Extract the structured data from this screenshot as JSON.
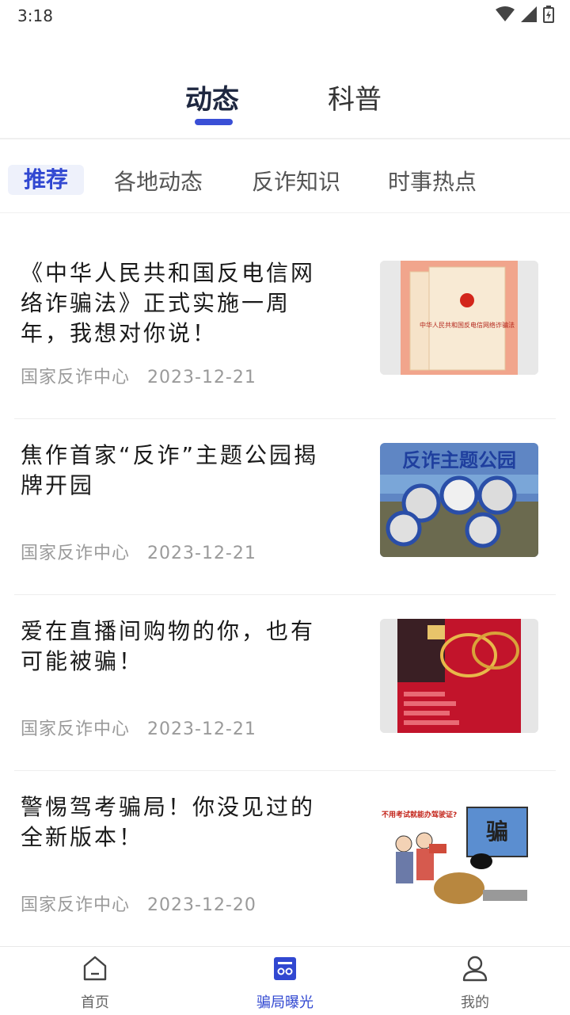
{
  "status_bar": {
    "time": "3:18"
  },
  "top_tabs": [
    {
      "label": "动态"
    },
    {
      "label": "科普"
    }
  ],
  "sub_tabs": [
    {
      "label": "推荐"
    },
    {
      "label": "各地动态"
    },
    {
      "label": "反诈知识"
    },
    {
      "label": "时事热点"
    }
  ],
  "news": [
    {
      "title": "《中华人民共和国反电信网络诈骗法》正式实施一周年，我想对你说！",
      "source": "国家反诈中心",
      "date": "2023-12-21",
      "thumb_text": "中华人民共和国反电信网络诈骗法"
    },
    {
      "title": "焦作首家“反诈”主题公园揭牌开园",
      "source": "国家反诈中心",
      "date": "2023-12-21",
      "thumb_text": "反诈主题公园"
    },
    {
      "title": "爱在直播间购物的你，也有可能被骗！",
      "source": "国家反诈中心",
      "date": "2023-12-21",
      "thumb_text": ""
    },
    {
      "title": "警惕驾考骗局！你没见过的全新版本！",
      "source": "国家反诈中心",
      "date": "2023-12-20",
      "thumb_text": "不用考试就能办驾驶证?",
      "thumb_text2": "骗"
    }
  ],
  "bottom_nav": [
    {
      "label": "首页",
      "icon": "home-icon"
    },
    {
      "label": "骗局曝光",
      "icon": "exposure-icon"
    },
    {
      "label": "我的",
      "icon": "user-icon"
    }
  ],
  "colors": {
    "accent": "#3148d1",
    "indicator": "#3a4fd6"
  }
}
